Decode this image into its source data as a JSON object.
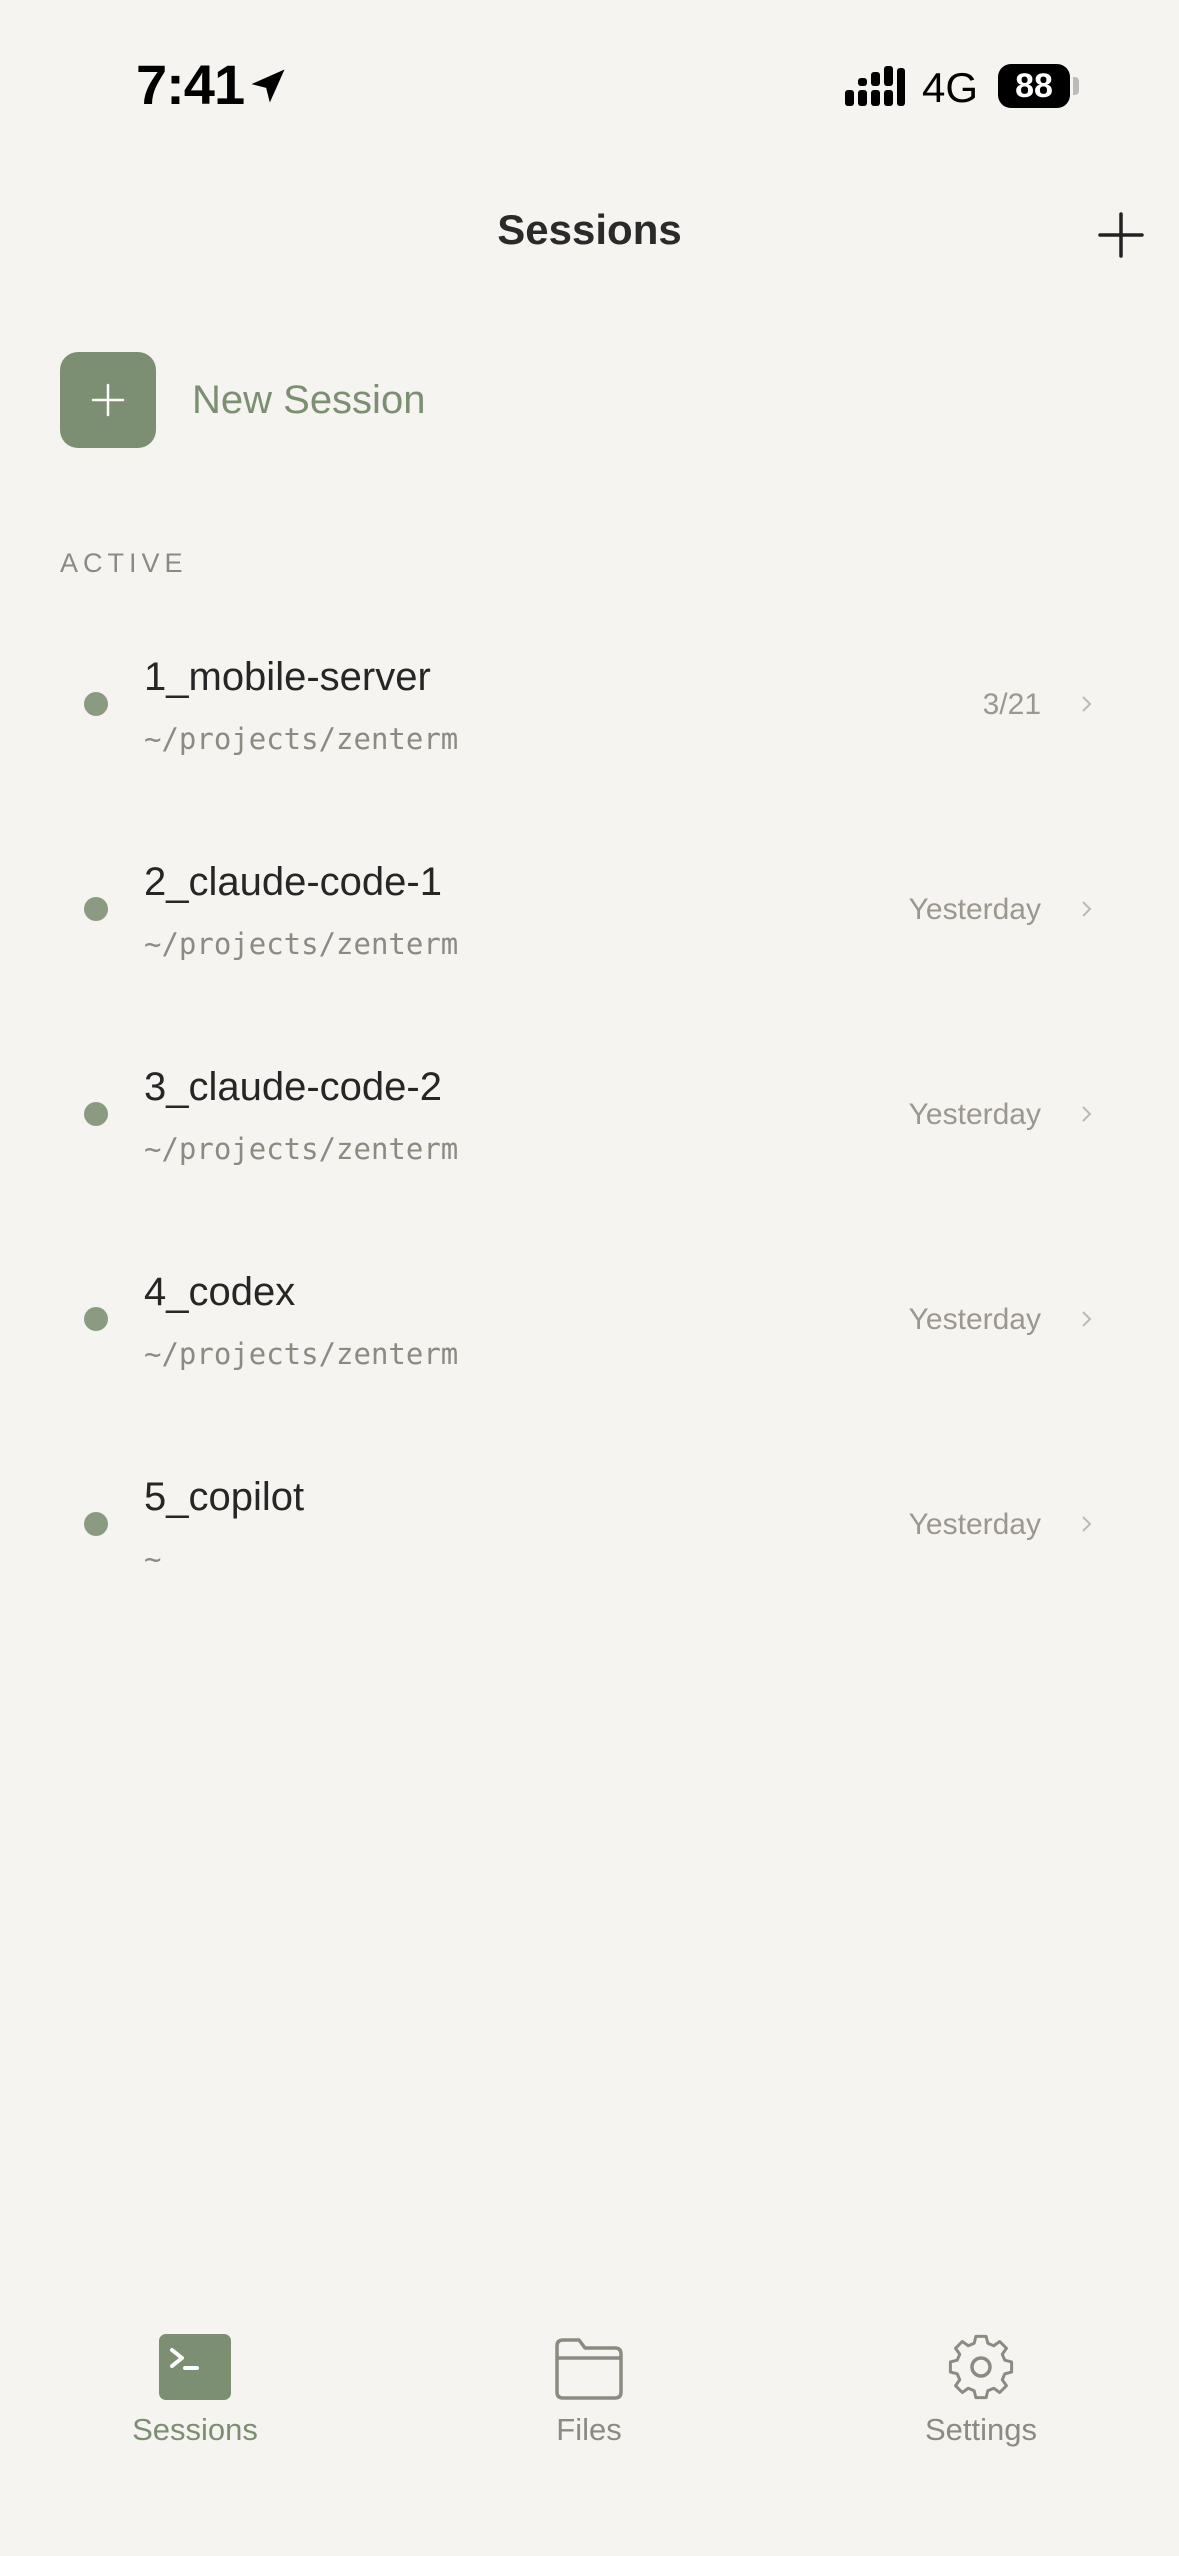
{
  "status_bar": {
    "time": "7:41",
    "network": "4G",
    "battery": "88"
  },
  "header": {
    "title": "Sessions"
  },
  "new_session": {
    "label": "New Session"
  },
  "section": {
    "active_label": "ACTIVE"
  },
  "sessions": [
    {
      "name": "1_mobile-server",
      "path": "~/projects/zenterm",
      "time": "3/21"
    },
    {
      "name": "2_claude-code-1",
      "path": "~/projects/zenterm",
      "time": "Yesterday"
    },
    {
      "name": "3_claude-code-2",
      "path": "~/projects/zenterm",
      "time": "Yesterday"
    },
    {
      "name": "4_codex",
      "path": "~/projects/zenterm",
      "time": "Yesterday"
    },
    {
      "name": "5_copilot",
      "path": "~",
      "time": "Yesterday"
    }
  ],
  "tabs": [
    {
      "label": "Sessions",
      "icon": "terminal-icon",
      "active": true
    },
    {
      "label": "Files",
      "icon": "folder-icon",
      "active": false
    },
    {
      "label": "Settings",
      "icon": "gear-icon",
      "active": false
    }
  ],
  "colors": {
    "accent": "#7c8f72",
    "background": "#f5f4f0",
    "muted": "#8d8a82",
    "dot": "#8b9b82"
  }
}
